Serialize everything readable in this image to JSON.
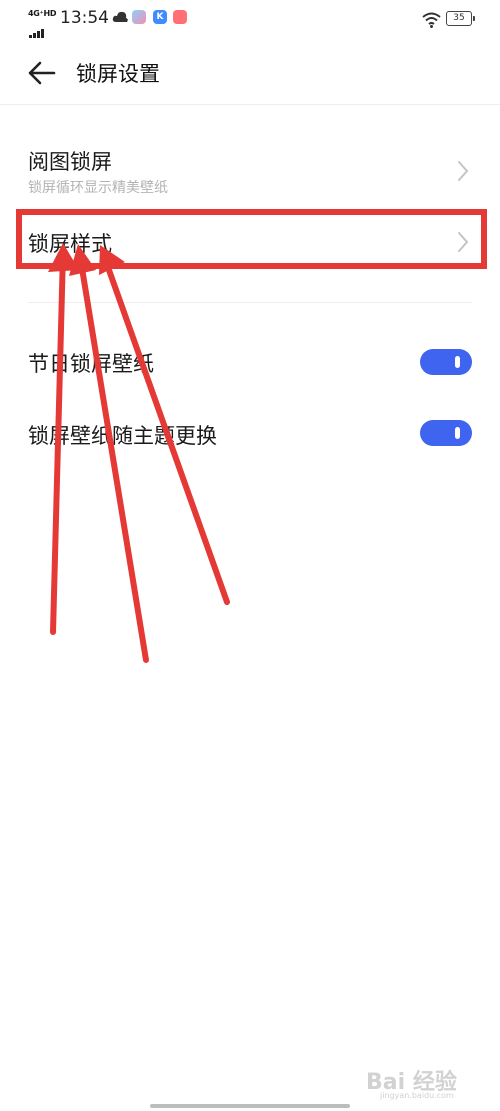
{
  "status_bar": {
    "network": "4G⁺HD",
    "time": "13:54",
    "battery": "35",
    "app_icons": [
      "cloud-icon",
      "app-icon-1",
      "app-icon-k",
      "app-icon-3"
    ]
  },
  "header": {
    "title": "锁屏设置",
    "back_icon": "back-arrow-icon"
  },
  "settings": {
    "items": [
      {
        "title": "阅图锁屏",
        "subtitle": "锁屏循环显示精美壁纸"
      },
      {
        "title": "锁屏样式"
      }
    ],
    "toggles": [
      {
        "label": "节日锁屏壁纸",
        "on": true
      },
      {
        "label": "锁屏壁纸随主题更换",
        "on": true
      }
    ]
  },
  "app_icon_labels": {
    "second": "K"
  },
  "colors": {
    "toggle_on": "#3e64f0",
    "annotation": "#e53935"
  },
  "watermark": {
    "text": "Bai 经验",
    "sub": "jingyan.baidu.com"
  }
}
